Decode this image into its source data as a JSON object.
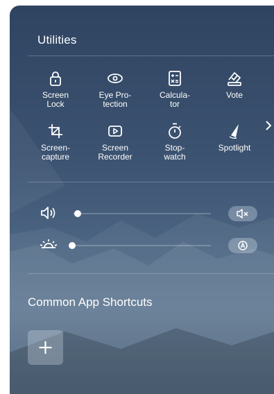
{
  "utilities": {
    "title": "Utilities",
    "tools": [
      {
        "label": "Screen\nLock",
        "icon": "lock-icon"
      },
      {
        "label": "Eye Pro-\ntection",
        "icon": "eye-icon"
      },
      {
        "label": "Calcula-\ntor",
        "icon": "calculator-icon"
      },
      {
        "label": "Vote",
        "icon": "vote-icon"
      },
      {
        "label": "Screen-\ncapture",
        "icon": "crop-icon"
      },
      {
        "label": "Screen\nRecorder",
        "icon": "record-icon"
      },
      {
        "label": "Stop-\nwatch",
        "icon": "stopwatch-icon"
      },
      {
        "label": "Spotlight",
        "icon": "spotlight-icon"
      }
    ],
    "next_icon": "chevron-right-icon"
  },
  "sliders": {
    "volume": {
      "icon": "speaker-icon",
      "level": 0.03,
      "toggle_icon": "mute-icon"
    },
    "brightness": {
      "icon": "sun-icon",
      "level": 0.0,
      "toggle_icon": "auto-brightness-icon"
    }
  },
  "shortcuts": {
    "title": "Common App Shortcuts",
    "add_icon": "plus-icon"
  },
  "colors": {
    "accent": "#5aa0ff",
    "text": "#ffffff",
    "panel_top": "#2f4461",
    "panel_bottom": "#59718c"
  }
}
